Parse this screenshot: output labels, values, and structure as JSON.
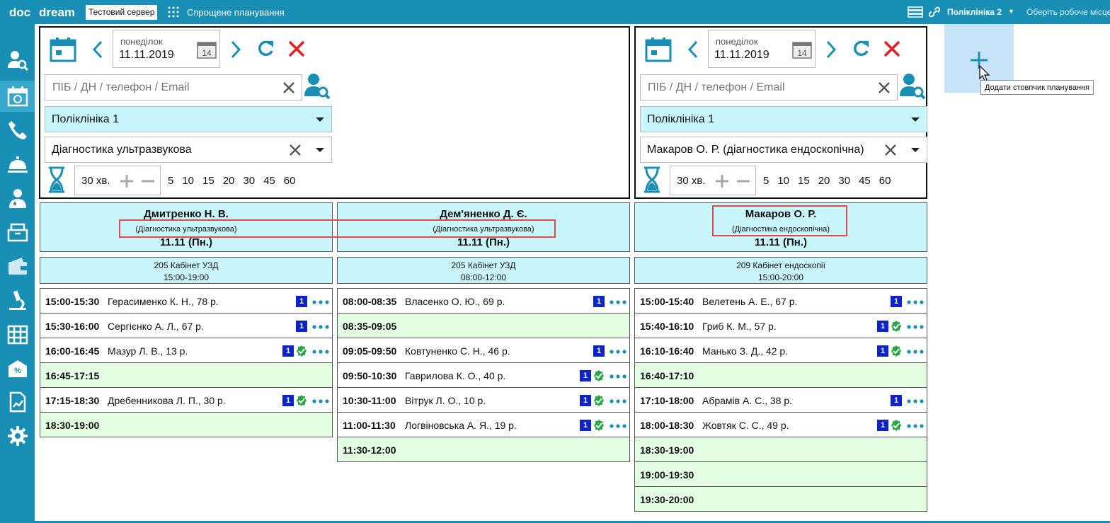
{
  "topbar": {
    "logo_doc": "doc",
    "logo_dream": "dream",
    "server_badge": "Тестовий сервер",
    "title": "Спрощене планування",
    "clinic": "Поліклініка 2",
    "workplace": "Оберіть робоче місце"
  },
  "sidebar": {
    "icons": [
      "patient-search-icon",
      "schedule-icon",
      "phone-icon",
      "reception-bell-icon",
      "doctor-icon",
      "registry-icon",
      "wallet-icon",
      "lab-microscope-icon",
      "timetable-icon",
      "discount-mail-icon",
      "report-chart-icon",
      "settings-icon"
    ]
  },
  "panels": [
    {
      "day_name": "понеділок",
      "date": "11.11.2019",
      "date_icon_day": "14",
      "search_placeholder": "ПІБ / ДН / телефон / Email",
      "clinic": "Поліклініка 1",
      "service": "Діагностика ультразвукова",
      "interval": "30 хв.",
      "steps": [
        "5",
        "10",
        "15",
        "20",
        "30",
        "45",
        "60"
      ]
    },
    {
      "day_name": "понеділок",
      "date": "11.11.2019",
      "date_icon_day": "14",
      "search_placeholder": "ПІБ / ДН / телефон / Email",
      "clinic": "Поліклініка 1",
      "service": "Макаров О. Р. (діагностика ендоскопічна)",
      "interval": "30 хв.",
      "steps": [
        "5",
        "10",
        "15",
        "20",
        "30",
        "45",
        "60"
      ]
    }
  ],
  "add_column_tooltip": "Додати стовпчик планування",
  "columns": [
    {
      "doctor": "Дмитренко Н. В.",
      "specialty": "(Діагностика ультразвукова)",
      "date": "11.11 (Пн.)",
      "cabinet": "205 Кабінет УЗД",
      "hours": "15:00-19:00",
      "slots": [
        {
          "time": "15:00-15:30",
          "patient": "Герасименко К. Н., 78 р.",
          "badge": "1",
          "confirmed": false
        },
        {
          "time": "15:30-16:00",
          "patient": "Сергієнко А. Л., 67 р.",
          "badge": "1",
          "confirmed": false
        },
        {
          "time": "16:00-16:45",
          "patient": "Мазур Л. В., 13 р.",
          "badge": "1",
          "confirmed": true
        },
        {
          "time": "16:45-17:15",
          "patient": "",
          "badge": "",
          "confirmed": false
        },
        {
          "time": "17:15-18:30",
          "patient": "Дребенникова Л. П., 30 р.",
          "badge": "1",
          "confirmed": true
        },
        {
          "time": "18:30-19:00",
          "patient": "",
          "badge": "",
          "confirmed": false
        }
      ]
    },
    {
      "doctor": "Дем'яненко Д. Є.",
      "specialty": "(Діагностика ультразвукова)",
      "date": "11.11 (Пн.)",
      "cabinet": "205 Кабінет УЗД",
      "hours": "08:00-12:00",
      "slots": [
        {
          "time": "08:00-08:35",
          "patient": "Власенко О. Ю., 69 р.",
          "badge": "1",
          "confirmed": false
        },
        {
          "time": "08:35-09:05",
          "patient": "",
          "badge": "",
          "confirmed": false
        },
        {
          "time": "09:05-09:50",
          "patient": "Ковтуненко С. Н., 46 р.",
          "badge": "1",
          "confirmed": false
        },
        {
          "time": "09:50-10:30",
          "patient": "Гаврилова К. О., 40 р.",
          "badge": "1",
          "confirmed": true
        },
        {
          "time": "10:30-11:00",
          "patient": "Вітрук Л. О., 10 р.",
          "badge": "1",
          "confirmed": true
        },
        {
          "time": "11:00-11:30",
          "patient": "Логвіновська А. Я., 19 р.",
          "badge": "1",
          "confirmed": true
        },
        {
          "time": "11:30-12:00",
          "patient": "",
          "badge": "",
          "confirmed": false
        }
      ]
    },
    {
      "doctor": "Макаров О. Р.",
      "specialty": "(Діагностика ендоскопічна)",
      "date": "11.11 (Пн.)",
      "cabinet": "209 Кабінет ендоскопії",
      "hours": "15:00-20:00",
      "slots": [
        {
          "time": "15:00-15:40",
          "patient": "Велетень А. Е., 67 р.",
          "badge": "1",
          "confirmed": false
        },
        {
          "time": "15:40-16:10",
          "patient": "Гриб К. М., 57 р.",
          "badge": "1",
          "confirmed": true
        },
        {
          "time": "16:10-16:40",
          "patient": "Манько З. Д., 42 р.",
          "badge": "1",
          "confirmed": true
        },
        {
          "time": "16:40-17:10",
          "patient": "",
          "badge": "",
          "confirmed": false
        },
        {
          "time": "17:10-18:00",
          "patient": "Абрамів А. С., 38 р.",
          "badge": "1",
          "confirmed": false
        },
        {
          "time": "18:00-18:30",
          "patient": "Жовтяк С. С., 49 р.",
          "badge": "1",
          "confirmed": true
        },
        {
          "time": "18:30-19:00",
          "patient": "",
          "badge": "",
          "confirmed": false
        },
        {
          "time": "19:00-19:30",
          "patient": "",
          "badge": "",
          "confirmed": false
        },
        {
          "time": "19:30-20:00",
          "patient": "",
          "badge": "",
          "confirmed": false
        }
      ]
    }
  ],
  "colors": {
    "brand": "#1a8fb5",
    "header_bg": "#c9f5fd",
    "free_slot": "#e2fde2",
    "badge": "#0c23c9",
    "confirmed": "#27a845",
    "delete": "#e02020",
    "highlight": "#e24b4b"
  }
}
